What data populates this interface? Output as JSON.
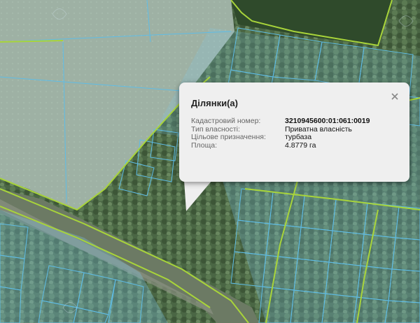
{
  "map": {
    "layers": [
      "aerial-imagery",
      "cadastral-parcels"
    ],
    "colors": {
      "parcel_outline": "#5fbde6",
      "parcel_fill": "#7fc7ea",
      "boundary_line": "#a8d43a",
      "field": "#8c9c82",
      "forest": "#3f5c3a"
    }
  },
  "popup": {
    "title": "Ділянки(а)",
    "close_icon": "close-icon",
    "rows": [
      {
        "label": "Кадастровий номер:",
        "value": "3210945600:01:061:0019",
        "bold": true
      },
      {
        "label": "Тип власності:",
        "value": "Приватна власність"
      },
      {
        "label": "Цільове призначення:",
        "value": "турбаза"
      },
      {
        "label": "Площа:",
        "value": "4.8779 га"
      }
    ]
  }
}
